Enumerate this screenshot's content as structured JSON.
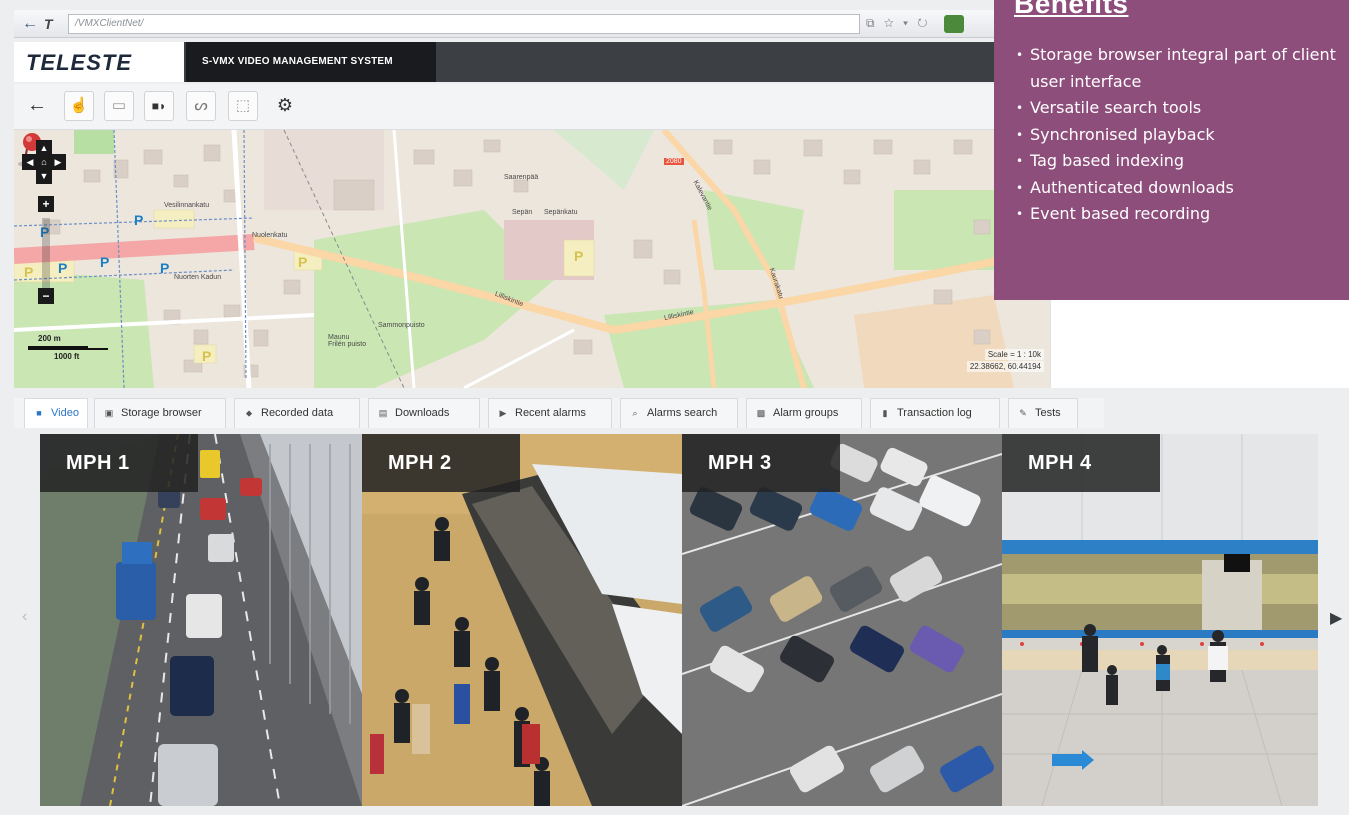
{
  "browser": {
    "url": "/VMXClientNet/",
    "forward_glyph": "T",
    "icons": "⧉ ☆ ▾ ↻"
  },
  "header": {
    "logo": "TELESTE",
    "system_title": "S-VMX VIDEO MANAGEMENT SYSTEM"
  },
  "toolbar": {
    "tools": [
      {
        "name": "back-arrow-icon",
        "glyph": "←"
      },
      {
        "name": "hand-pan-icon",
        "glyph": "☝"
      },
      {
        "name": "rectangle-select-icon",
        "glyph": "▭"
      },
      {
        "name": "camera-audio-icon",
        "glyph": "■◗"
      },
      {
        "name": "lasso-icon",
        "glyph": "ᔕ"
      },
      {
        "name": "zoom-area-icon",
        "glyph": "⬚"
      },
      {
        "name": "settings-gear-icon",
        "glyph": "⚙"
      }
    ]
  },
  "map": {
    "zoom_in": "+",
    "zoom_out": "−",
    "scale_metric": "200 m",
    "scale_imperial": "1000 ft",
    "scale_readout": "Scale = 1 : 10k",
    "coords_readout": "22.38662, 60.44194",
    "streets": [
      "Sepän",
      "Sepänkatu",
      "Lilliskintie",
      "Lilliskintie",
      "Nuolenkatu",
      "Kalevantie",
      "Kaurakatu",
      "Saarenpää",
      "Sammonpuisto",
      "Maunu Frilén puisto",
      "Nuorten Kadun",
      "Vesilinnankatu"
    ],
    "road_number": "2080",
    "parking_symbol": "P"
  },
  "benefits": {
    "title": "Benefits",
    "bullet": "•",
    "items": [
      "Storage browser integral part of client user interface",
      "Versatile search tools",
      "Synchronised playback",
      "Tag based indexing",
      "Authenticated downloads",
      "Event based recording"
    ]
  },
  "tabs": [
    {
      "label": "Video",
      "icon": "video-icon",
      "glyph": "■",
      "active": true
    },
    {
      "label": "Storage browser",
      "icon": "storage-icon",
      "glyph": "▣",
      "active": false
    },
    {
      "label": "Recorded data",
      "icon": "recorded-data-icon",
      "glyph": "⬥",
      "active": false
    },
    {
      "label": "Downloads",
      "icon": "downloads-icon",
      "glyph": "▤",
      "active": false
    },
    {
      "label": "Recent alarms",
      "icon": "recent-alarms-icon",
      "glyph": "▶",
      "active": false
    },
    {
      "label": "Alarms search",
      "icon": "search-icon",
      "glyph": "⌕",
      "active": false
    },
    {
      "label": "Alarm groups",
      "icon": "alarm-groups-icon",
      "glyph": "▩",
      "active": false
    },
    {
      "label": "Transaction log",
      "icon": "transaction-log-icon",
      "glyph": "▮",
      "active": false
    },
    {
      "label": "Tests",
      "icon": "tests-icon",
      "glyph": "✎",
      "active": false
    }
  ],
  "video": {
    "prev": "‹",
    "next": "▶",
    "tiles": [
      {
        "label": "MPH 1"
      },
      {
        "label": "MPH 2"
      },
      {
        "label": "MPH 3"
      },
      {
        "label": "MPH 4"
      }
    ]
  },
  "colors": {
    "benefits_bg": "#8e4e7c",
    "header_dark": "#1a1b1e",
    "tab_active": "#2a76c9"
  }
}
